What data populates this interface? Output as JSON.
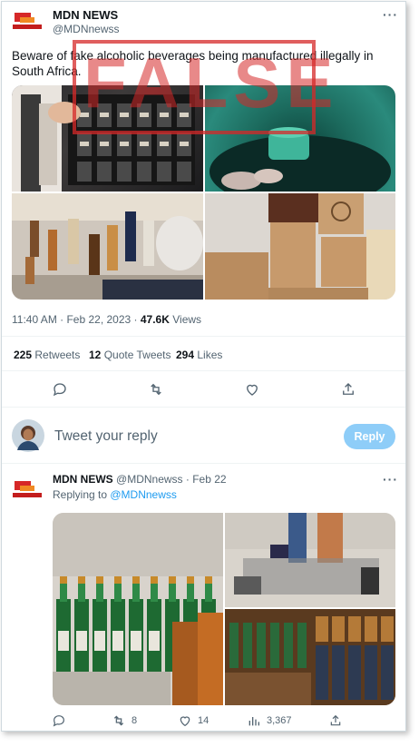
{
  "tweet": {
    "author_name": "MDN NEWS",
    "author_handle": "@MDNnewss",
    "more": "···",
    "text": "Beware of fake alcoholic beverages being manufactured illegally in South Africa.",
    "stamp_text": "FALSE",
    "time": "11:40 AM · Feb 22, 2023 · ",
    "views_count": "47.6K",
    "views_label": " Views",
    "retweets_count": "225",
    "retweets_label": " Retweets",
    "quotes_count": "12",
    "quotes_label": " Quote Tweets",
    "likes_count": "294",
    "likes_label": " Likes"
  },
  "compose": {
    "placeholder": "Tweet your reply",
    "reply_button": "Reply"
  },
  "reply": {
    "author_name": "MDN NEWS",
    "author_handle": "@MDNnewss",
    "date": " · Feb 22",
    "more": "···",
    "replying_prefix": "Replying to ",
    "replying_handle": "@MDNnewss",
    "retweets": "8",
    "likes": "14",
    "views": "3,367"
  },
  "colors": {
    "accent": "#1d9bf0",
    "reply_button": "#8ecdf8",
    "stamp": "#d62828"
  }
}
